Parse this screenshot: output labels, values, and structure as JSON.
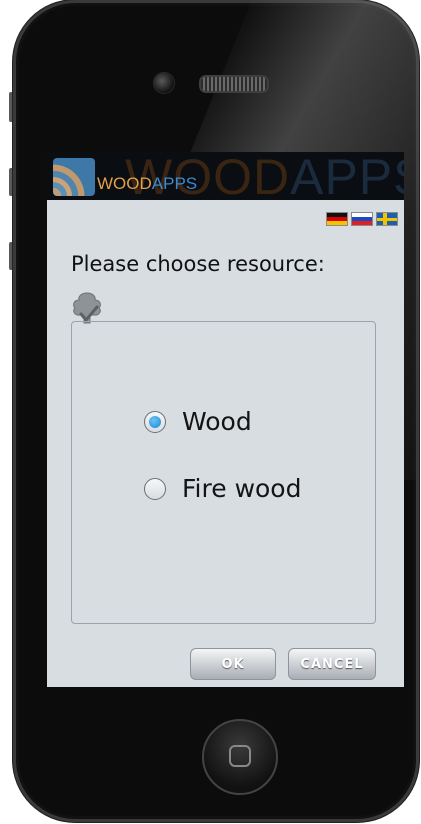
{
  "header": {
    "logo_wood": "WOOD",
    "logo_apps": "APPS",
    "banner_wood": "WOOD",
    "banner_apps": "APPS"
  },
  "languages": [
    {
      "name": "German",
      "icon": "flag-de-icon"
    },
    {
      "name": "Slovenian",
      "icon": "flag-si-icon"
    },
    {
      "name": "Swedish",
      "icon": "flag-se-icon"
    }
  ],
  "prompt": "Please choose resource:",
  "resources": {
    "options": [
      {
        "label": "Wood",
        "checked": true
      },
      {
        "label": "Fire wood",
        "checked": false
      }
    ]
  },
  "buttons": {
    "ok": "OK",
    "cancel": "CANCEL"
  },
  "colors": {
    "screen_bg": "#d8dde2",
    "radio_selected": "#1689d6",
    "logo_wood": "#e1a04a",
    "logo_apps": "#3a8bd0"
  }
}
